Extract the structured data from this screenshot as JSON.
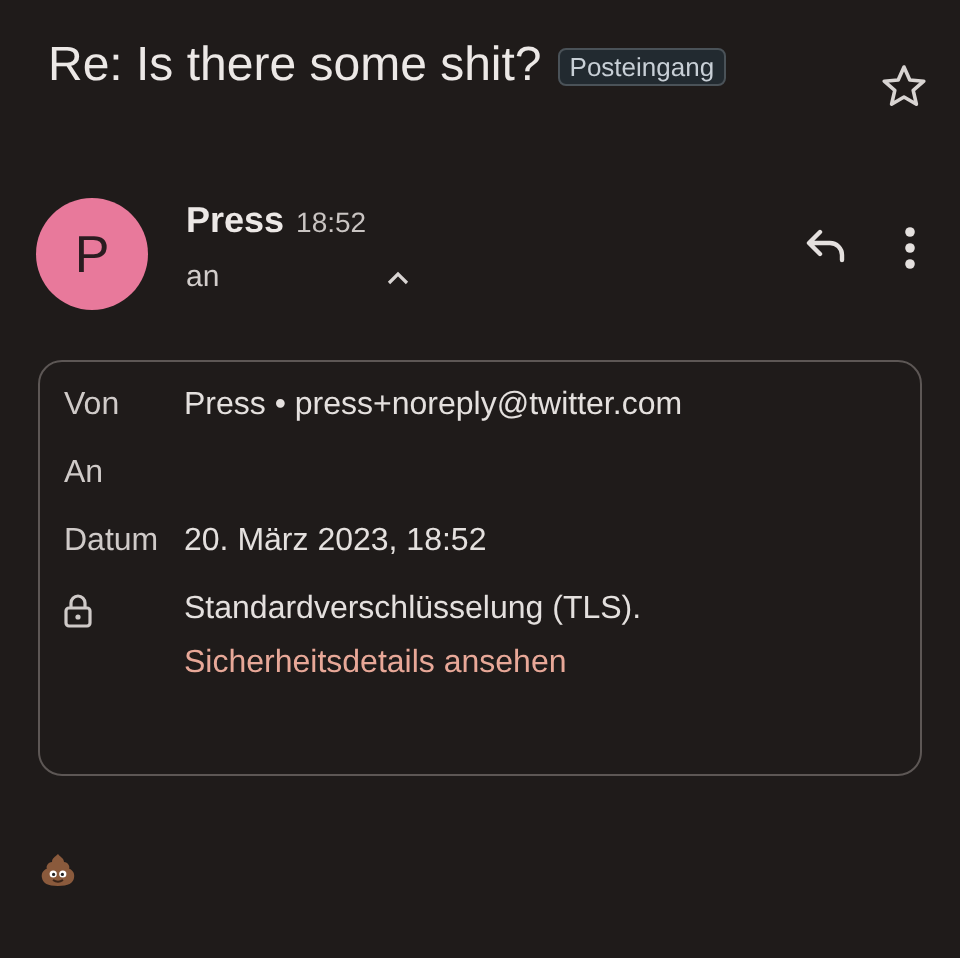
{
  "subject": {
    "title": "Re: Is there some shit?",
    "label": "Posteingang",
    "starred": false
  },
  "message": {
    "avatar_letter": "P",
    "sender": "Press",
    "time": "18:52",
    "to_label": "an",
    "details_expanded": true
  },
  "details": {
    "rows": [
      {
        "kind": "text",
        "label": "Von",
        "value": "Press • press+noreply@twitter.com"
      },
      {
        "kind": "text",
        "label": "An"
      },
      {
        "kind": "text",
        "label": "Datum",
        "value": "20. März 2023, 18:52"
      },
      {
        "kind": "security",
        "value": "Standardverschlüsselung (TLS).",
        "link": "Sicherheitsdetails ansehen"
      }
    ]
  }
}
